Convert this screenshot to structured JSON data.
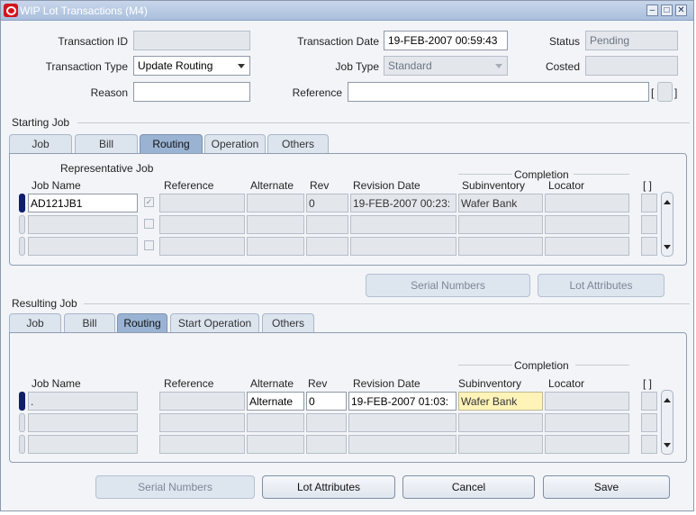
{
  "window": {
    "title": "WIP Lot Transactions (M4)",
    "controls": [
      "minimize",
      "maximize",
      "close"
    ]
  },
  "header": {
    "transaction_id_label": "Transaction ID",
    "transaction_id_value": "",
    "transaction_date_label": "Transaction Date",
    "transaction_date_value": "19-FEB-2007 00:59:43",
    "status_label": "Status",
    "status_value": "Pending",
    "transaction_type_label": "Transaction Type",
    "transaction_type_value": "Update Routing",
    "job_type_label": "Job Type",
    "job_type_value": "Standard",
    "costed_label": "Costed",
    "costed_value": "",
    "reason_label": "Reason",
    "reason_value": "",
    "reference_label": "Reference",
    "reference_value": "",
    "bracket": "[ ]"
  },
  "starting_job": {
    "section_label": "Starting Job",
    "tabs": [
      "Job",
      "Bill",
      "Routing",
      "Operation",
      "Others"
    ],
    "active_tab": "Routing",
    "representative_job_label": "Representative Job",
    "columns": {
      "job_name": "Job Name",
      "reference": "Reference",
      "alternate": "Alternate",
      "rev": "Rev",
      "revision_date": "Revision Date",
      "completion": "Completion",
      "subinventory": "Subinventory",
      "locator": "Locator",
      "bracket": "[ ]"
    },
    "rows": [
      {
        "job_name": "AD121JB1",
        "checked": "✓",
        "reference": "",
        "alternate": "",
        "rev": "0",
        "revision_date": "19-FEB-2007 00:23:",
        "subinventory": "Wafer Bank",
        "locator": ""
      },
      {
        "job_name": "",
        "checked": "",
        "reference": "",
        "alternate": "",
        "rev": "",
        "revision_date": "",
        "subinventory": "",
        "locator": ""
      },
      {
        "job_name": "",
        "checked": "",
        "reference": "",
        "alternate": "",
        "rev": "",
        "revision_date": "",
        "subinventory": "",
        "locator": ""
      }
    ],
    "buttons": {
      "serial_numbers": "Serial Numbers",
      "lot_attributes": "Lot Attributes"
    }
  },
  "resulting_job": {
    "section_label": "Resulting Job",
    "tabs": [
      "Job",
      "Bill",
      "Routing",
      "Start Operation",
      "Others"
    ],
    "active_tab": "Routing",
    "columns": {
      "job_name": "Job Name",
      "reference": "Reference",
      "alternate": "Alternate",
      "rev": "Rev",
      "revision_date": "Revision Date",
      "completion": "Completion",
      "subinventory": "Subinventory",
      "locator": "Locator",
      "bracket": "[ ]"
    },
    "rows": [
      {
        "job_name": ".",
        "reference": "",
        "alternate": "Alternate",
        "rev": "0",
        "revision_date": "19-FEB-2007 01:03:",
        "subinventory": "Wafer Bank",
        "locator": ""
      },
      {
        "job_name": "",
        "reference": "",
        "alternate": "",
        "rev": "",
        "revision_date": "",
        "subinventory": "",
        "locator": ""
      },
      {
        "job_name": "",
        "reference": "",
        "alternate": "",
        "rev": "",
        "revision_date": "",
        "subinventory": "",
        "locator": ""
      }
    ]
  },
  "footer": {
    "serial_numbers": "Serial Numbers",
    "lot_attributes": "Lot Attributes",
    "cancel": "Cancel",
    "save": "Save"
  }
}
